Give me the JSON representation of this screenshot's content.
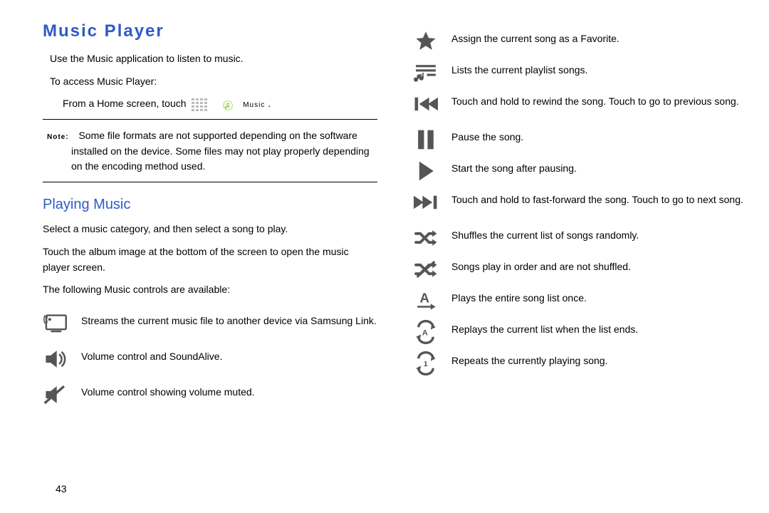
{
  "page_number": "43",
  "left": {
    "title": "Music Player",
    "p1": "Use the Music application to listen to music.",
    "p2": "To access Music Player:",
    "p3_pre": "From a Home screen, touch",
    "p3_app_label": "Music",
    "p3_post": ".",
    "note_label": "Note:",
    "note_body": "Some file formats are not supported depending on the software installed on the device. Some files may not play properly depending on the encoding method used.",
    "sub_title": "Playing Music",
    "p4": "Select a music category, and then select a song to play.",
    "p5": "Touch the album image at the bottom of the screen to open the music player screen.",
    "p6": "The following Music controls are available:",
    "controls": [
      {
        "icon": "stream",
        "text": "Streams the current music file to another device via Samsung Link."
      },
      {
        "icon": "volume",
        "text": "Volume control and SoundAlive."
      },
      {
        "icon": "volume-muted",
        "text": "Volume control showing volume muted."
      }
    ]
  },
  "right": {
    "controls": [
      {
        "icon": "star",
        "text": "Assign the current song as a Favorite."
      },
      {
        "icon": "playlist",
        "text": "Lists the current playlist songs."
      },
      {
        "icon": "rewind",
        "text": "Touch and hold to rewind the song. Touch to go to previous song."
      },
      {
        "icon": "pause",
        "text": "Pause the song."
      },
      {
        "icon": "play",
        "text": "Start the song after pausing."
      },
      {
        "icon": "fast-forward",
        "text": "Touch and hold to fast-forward the song. Touch to go to next song."
      },
      {
        "icon": "shuffle-on",
        "text": "Shuffles the current list of songs randomly."
      },
      {
        "icon": "shuffle-off",
        "text": "Songs play in order and are not shuffled."
      },
      {
        "icon": "play-all-once",
        "text": "Plays the entire song list once."
      },
      {
        "icon": "repeat-all",
        "text": "Replays the current list when the list ends."
      },
      {
        "icon": "repeat-one",
        "text": "Repeats the currently playing song."
      }
    ]
  }
}
